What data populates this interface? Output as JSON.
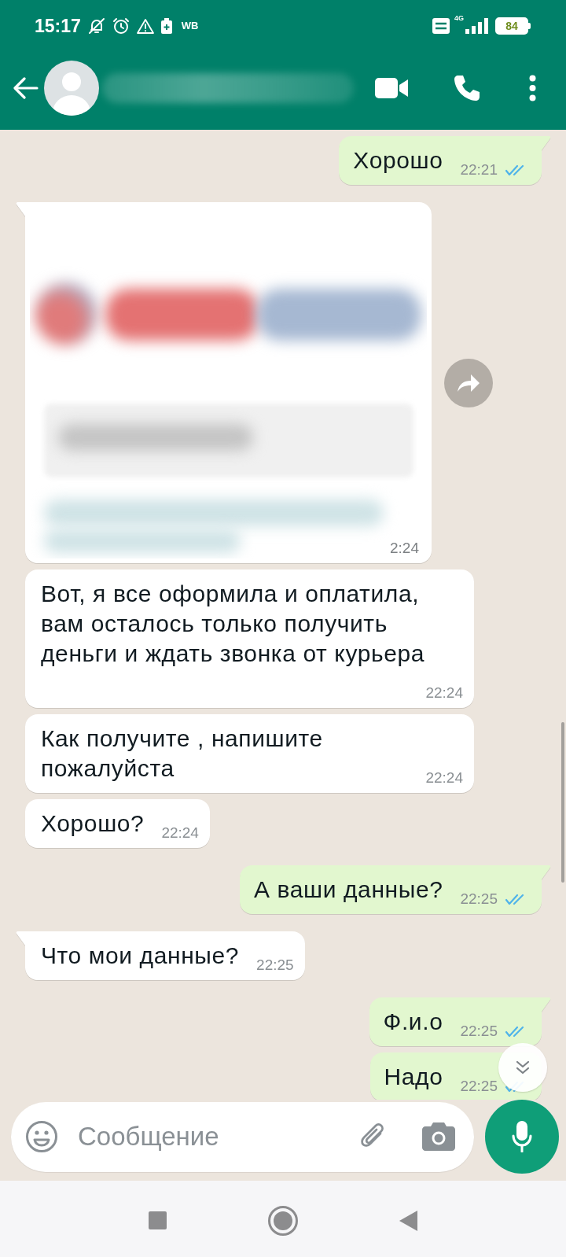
{
  "status_bar": {
    "time": "15:17",
    "app_label": "WB",
    "network": "4G",
    "battery": "84"
  },
  "messages": [
    {
      "kind": "text",
      "outgoing": true,
      "text": "Хорошо",
      "time": "22:21",
      "read": true
    },
    {
      "kind": "blurred_preview",
      "outgoing": false,
      "time": "2:24"
    },
    {
      "kind": "text",
      "outgoing": false,
      "text": "Вот, я все оформила и оплатила, вам осталось только получить деньги и ждать звонка от курьера",
      "time": "22:24"
    },
    {
      "kind": "text",
      "outgoing": false,
      "text": "Как получите , напишите пожалуйста",
      "time": "22:24"
    },
    {
      "kind": "text",
      "outgoing": false,
      "text": "Хорошо?",
      "time": "22:24"
    },
    {
      "kind": "text",
      "outgoing": true,
      "text": "А ваши данные?",
      "time": "22:25",
      "read": true
    },
    {
      "kind": "text",
      "outgoing": false,
      "text": "Что мои данные?",
      "time": "22:25"
    },
    {
      "kind": "text",
      "outgoing": true,
      "text": "Ф.и.о",
      "time": "22:25",
      "read": true
    },
    {
      "kind": "text",
      "outgoing": true,
      "text": "Надо",
      "time": "22:25",
      "read": true
    }
  ],
  "composer": {
    "placeholder": "Сообщение"
  }
}
